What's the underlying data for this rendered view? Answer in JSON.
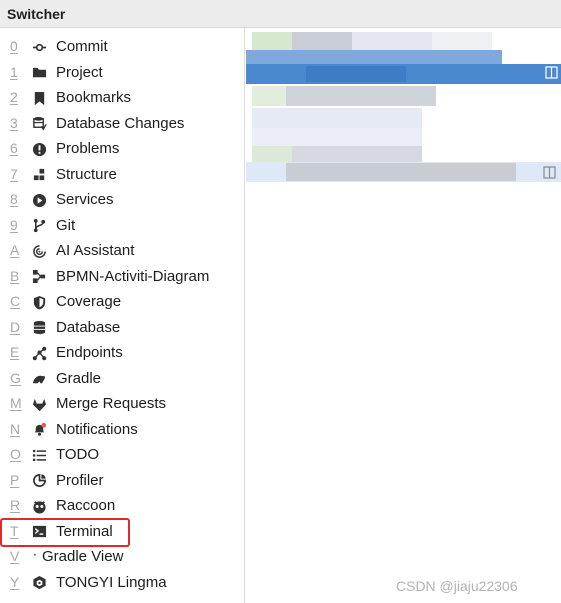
{
  "window": {
    "title": "Switcher"
  },
  "items": [
    {
      "mnemonic": "0",
      "label": "Commit",
      "icon": "commit-icon"
    },
    {
      "mnemonic": "1",
      "label": "Project",
      "icon": "folder-icon"
    },
    {
      "mnemonic": "2",
      "label": "Bookmarks",
      "icon": "bookmark-icon"
    },
    {
      "mnemonic": "3",
      "label": "Database Changes",
      "icon": "database-changes-icon"
    },
    {
      "mnemonic": "6",
      "label": "Problems",
      "icon": "problems-icon"
    },
    {
      "mnemonic": "7",
      "label": "Structure",
      "icon": "structure-icon"
    },
    {
      "mnemonic": "8",
      "label": "Services",
      "icon": "services-icon"
    },
    {
      "mnemonic": "9",
      "label": "Git",
      "icon": "git-icon"
    },
    {
      "mnemonic": "A",
      "label": "AI Assistant",
      "icon": "ai-assistant-icon"
    },
    {
      "mnemonic": "B",
      "label": "BPMN-Activiti-Diagram",
      "icon": "bpmn-icon"
    },
    {
      "mnemonic": "C",
      "label": "Coverage",
      "icon": "coverage-icon"
    },
    {
      "mnemonic": "D",
      "label": "Database",
      "icon": "database-icon"
    },
    {
      "mnemonic": "E",
      "label": "Endpoints",
      "icon": "endpoints-icon"
    },
    {
      "mnemonic": "G",
      "label": "Gradle",
      "icon": "gradle-icon"
    },
    {
      "mnemonic": "M",
      "label": "Merge Requests",
      "icon": "merge-requests-icon"
    },
    {
      "mnemonic": "N",
      "label": "Notifications",
      "icon": "notifications-icon"
    },
    {
      "mnemonic": "O",
      "label": "TODO",
      "icon": "todo-icon"
    },
    {
      "mnemonic": "P",
      "label": "Profiler",
      "icon": "profiler-icon"
    },
    {
      "mnemonic": "R",
      "label": "Raccoon",
      "icon": "raccoon-icon"
    },
    {
      "mnemonic": "T",
      "label": "Terminal",
      "icon": "terminal-icon"
    },
    {
      "mnemonic": "V",
      "label": "Gradle View",
      "icon": "dot-icon"
    },
    {
      "mnemonic": "Y",
      "label": "TONGYI Lingma",
      "icon": "tongyi-icon"
    }
  ],
  "highlight": {
    "item": "Terminal"
  },
  "watermark": "CSDN @jiaju22306",
  "colors": {
    "selection": "#4a88d0",
    "highlight_border": "#e02a2a",
    "mnemonic": "#a8a8a8"
  }
}
